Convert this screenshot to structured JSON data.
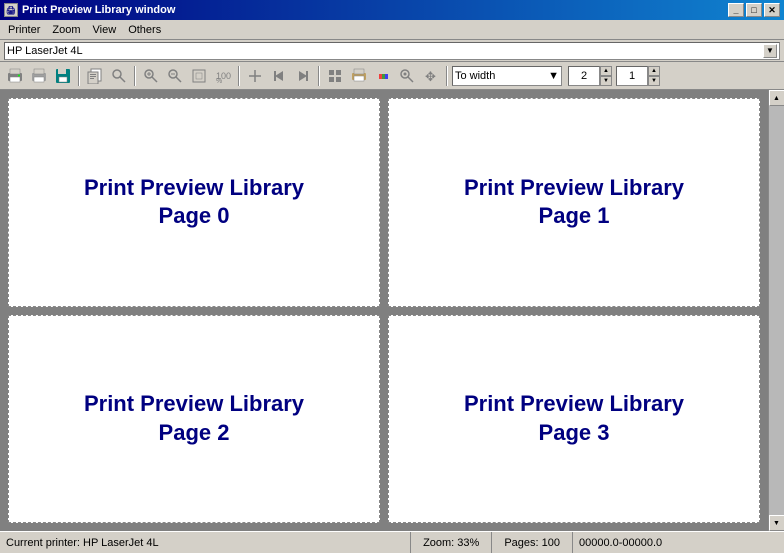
{
  "window": {
    "title": "Print Preview Library window",
    "title_icon": "🖨"
  },
  "title_buttons": {
    "minimize": "_",
    "maximize": "□",
    "close": "✕"
  },
  "menu": {
    "items": [
      "Printer",
      "View",
      "View",
      "Others"
    ]
  },
  "printer_bar": {
    "selected_printer": "HP LaserJet 4L",
    "dropdown_arrow": "▼"
  },
  "toolbar": {
    "zoom_label": "To width",
    "zoom_dropdown_arrow": "▼",
    "pages_value": "2",
    "page_value": "1",
    "icons": [
      {
        "name": "print-icon",
        "symbol": "🖨"
      },
      {
        "name": "setup-icon",
        "symbol": "⚙"
      },
      {
        "name": "save-icon",
        "symbol": "💾"
      },
      {
        "name": "copy-icon",
        "symbol": "📋"
      },
      {
        "name": "search-icon",
        "symbol": "🔍"
      },
      {
        "name": "zoom-in-icon",
        "symbol": "🔍"
      },
      {
        "name": "zoom-out-icon",
        "symbol": "🔎"
      },
      {
        "name": "fit-icon",
        "symbol": "⊞"
      },
      {
        "name": "percent-icon",
        "symbol": "%"
      },
      {
        "name": "add-page-icon",
        "symbol": "+"
      },
      {
        "name": "nav-left-icon",
        "symbol": "◄"
      },
      {
        "name": "nav-right-icon",
        "symbol": "►"
      },
      {
        "name": "layout-icon",
        "symbol": "▦"
      },
      {
        "name": "print2-icon",
        "symbol": "🖨"
      },
      {
        "name": "color-icon",
        "symbol": "🎨"
      },
      {
        "name": "zoom-select-icon",
        "symbol": "⊕"
      },
      {
        "name": "pan-icon",
        "symbol": "✋"
      },
      {
        "name": "move-icon",
        "symbol": "✥"
      }
    ]
  },
  "pages": [
    {
      "id": 0,
      "title": "Print Preview Library\nPage 0"
    },
    {
      "id": 1,
      "title": "Print Preview Library\nPage 1"
    },
    {
      "id": 2,
      "title": "Print Preview Library\nPage 2"
    },
    {
      "id": 3,
      "title": "Print Preview Library\nPage 3"
    }
  ],
  "status_bar": {
    "printer": "Current printer: HP LaserJet 4L",
    "zoom": "Zoom: 33%",
    "pages": "Pages: 100",
    "range": "00000.0-00000.0"
  },
  "scroll": {
    "up": "▲",
    "down": "▼"
  }
}
